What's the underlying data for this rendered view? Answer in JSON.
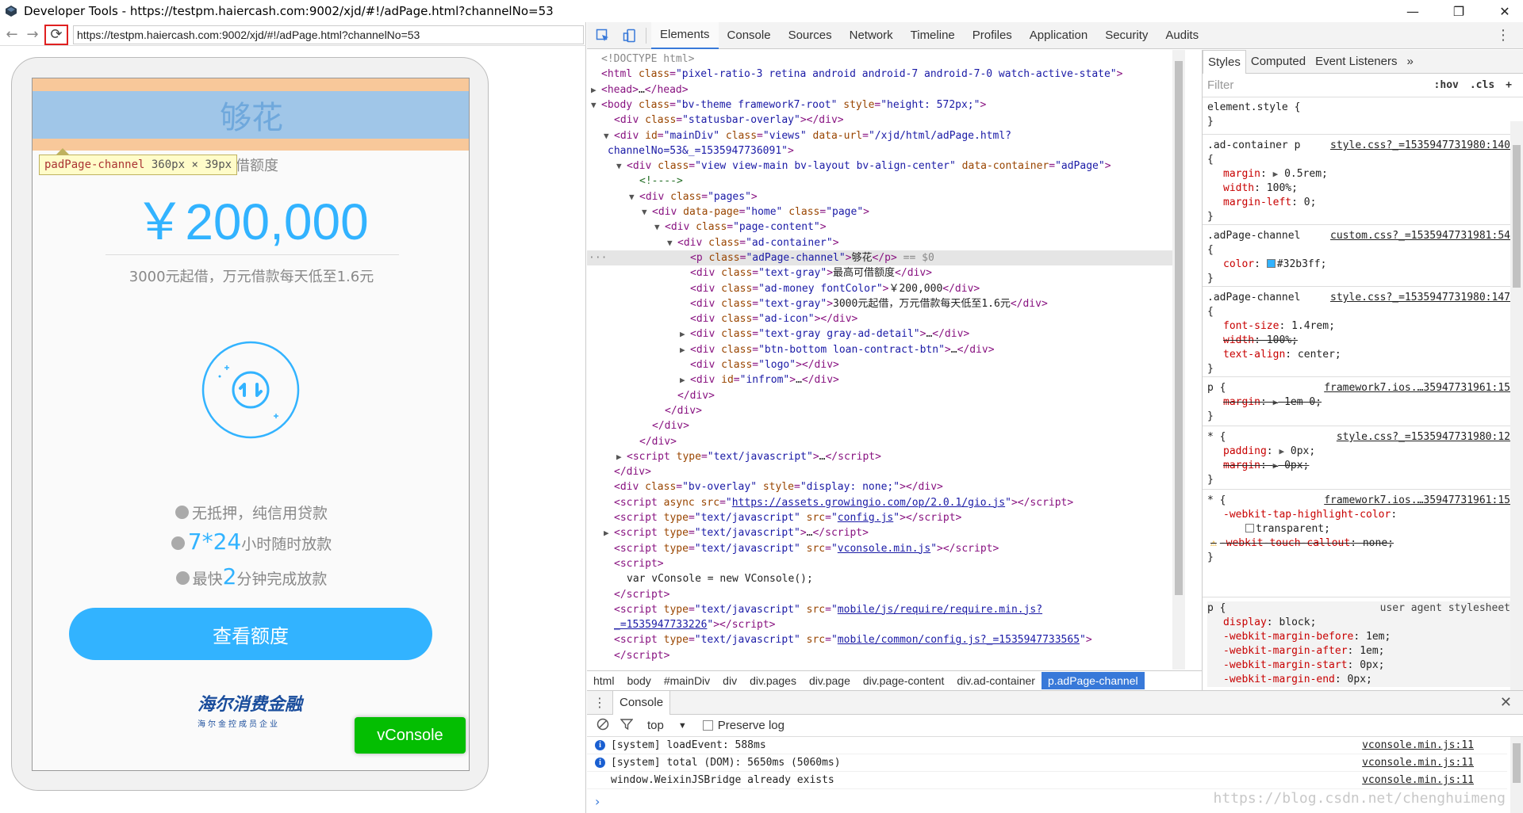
{
  "window": {
    "title": "Developer Tools - https://testpm.haiercash.com:9002/xjd/#!/adPage.html?channelNo=53",
    "minimize": "—",
    "restore": "❐",
    "close": "✕"
  },
  "device": {
    "url": "https://testpm.haiercash.com:9002/xjd/#!/adPage.html?channelNo=53",
    "channel_title": "够花",
    "tooltip": {
      "name": "padPage-channel",
      "width": "360",
      "x": "×",
      "height": "39",
      "unit": "px"
    },
    "max_label": "高可借额度",
    "money": "￥200,000",
    "sub_text": "3000元起借，万元借款每天低至1.6元",
    "feature1": "无抵押，纯信用贷款",
    "feature2_hl": "7*24",
    "feature2": "小时随时放款",
    "feature3_pre": "最快",
    "feature3_hl": "2",
    "feature3_post": "分钟完成放款",
    "cta": "查看额度",
    "logo_main": "海尔消费金融",
    "logo_sub": "海尔金控成员企业",
    "vconsole": "vConsole",
    "accent": "#32b3ff"
  },
  "devtools": {
    "tabs": [
      "Elements",
      "Console",
      "Sources",
      "Network",
      "Timeline",
      "Profiles",
      "Application",
      "Security",
      "Audits"
    ],
    "active_tab": "Elements",
    "breadcrumbs": [
      "html",
      "body",
      "#mainDiv",
      "div",
      "div.pages",
      "div.page",
      "div.page-content",
      "div.ad-container",
      "p.adPage-channel"
    ],
    "styles_tabs": [
      "Styles",
      "Computed",
      "Event Listeners",
      "»"
    ],
    "filter_placeholder": "Filter",
    "hov": ":hov",
    "cls": ".cls",
    "add": "+"
  },
  "tree": [
    {
      "i": 0,
      "html": "<span class='gr'>&lt;!DOCTYPE html&gt;</span>"
    },
    {
      "i": 0,
      "html": "<span class='tg'>&lt;html</span> <span class='an'>class</span>=<span class='av'>\"pixel-ratio-3 retina android android-7 android-7-0 watch-active-state\"</span><span class='tg'>&gt;</span>"
    },
    {
      "i": 0,
      "tri": "▶",
      "html": "<span class='tg'>&lt;head&gt;</span><span class='tx'>…</span><span class='tg'>&lt;/head&gt;</span>"
    },
    {
      "i": 0,
      "tri": "▼",
      "html": "<span class='tg'>&lt;body</span> <span class='an'>class</span>=<span class='av'>\"bv-theme framework7-root\"</span> <span class='an'>style</span>=<span class='av'>\"height: 572px;\"</span><span class='tg'>&gt;</span>"
    },
    {
      "i": 1,
      "html": "<span class='tg'>&lt;div</span> <span class='an'>class</span>=<span class='av'>\"statusbar-overlay\"</span><span class='tg'>&gt;&lt;/div&gt;</span>"
    },
    {
      "i": 1,
      "tri": "▼",
      "html": "<span class='tg'>&lt;div</span> <span class='an'>id</span>=<span class='av'>\"mainDiv\"</span> <span class='an'>class</span>=<span class='av'>\"views\"</span> <span class='an'>data-url</span>=<span class='av'>\"/xjd/html/adPage.html?</span>"
    },
    {
      "i": 0.5,
      "html": "<span class='av'>channelNo=53&amp;_=1535947736091\"</span><span class='tg'>&gt;</span>"
    },
    {
      "i": 2,
      "tri": "▼",
      "html": "<span class='tg'>&lt;div</span> <span class='an'>class</span>=<span class='av'>\"view view-main bv-layout bv-align-center\"</span> <span class='an'>data-container</span>=<span class='av'>\"adPage\"</span><span class='tg'>&gt;</span>"
    },
    {
      "i": 3,
      "html": "<span class='cm'>&lt;!----&gt;</span>"
    },
    {
      "i": 3,
      "tri": "▼",
      "html": "<span class='tg'>&lt;div</span> <span class='an'>class</span>=<span class='av'>\"pages\"</span><span class='tg'>&gt;</span>"
    },
    {
      "i": 4,
      "tri": "▼",
      "html": "<span class='tg'>&lt;div</span> <span class='an'>data-page</span>=<span class='av'>\"home\"</span> <span class='an'>class</span>=<span class='av'>\"page\"</span><span class='tg'>&gt;</span>"
    },
    {
      "i": 5,
      "tri": "▼",
      "html": "<span class='tg'>&lt;div</span> <span class='an'>class</span>=<span class='av'>\"page-content\"</span><span class='tg'>&gt;</span>"
    },
    {
      "i": 6,
      "tri": "▼",
      "html": "<span class='tg'>&lt;div</span> <span class='an'>class</span>=<span class='av'>\"ad-container\"</span><span class='tg'>&gt;</span>"
    },
    {
      "i": 7,
      "sel": true,
      "html": "<span class='tg'>&lt;p</span> <span class='an'>class</span>=<span class='av'>\"adPage-channel\"</span><span class='tg'>&gt;</span><span class='tx'>够花</span><span class='tg'>&lt;/p&gt;</span> <span class='gr'>== $0</span>"
    },
    {
      "i": 7,
      "html": "<span class='tg'>&lt;div</span> <span class='an'>class</span>=<span class='av'>\"text-gray\"</span><span class='tg'>&gt;</span><span class='tx'>最高可借额度</span><span class='tg'>&lt;/div&gt;</span>"
    },
    {
      "i": 7,
      "html": "<span class='tg'>&lt;div</span> <span class='an'>class</span>=<span class='av'>\"ad-money fontColor\"</span><span class='tg'>&gt;</span><span class='tx'>￥200,000</span><span class='tg'>&lt;/div&gt;</span>"
    },
    {
      "i": 7,
      "html": "<span class='tg'>&lt;div</span> <span class='an'>class</span>=<span class='av'>\"text-gray\"</span><span class='tg'>&gt;</span><span class='tx'>3000元起借，万元借款每天低至1.6元</span><span class='tg'>&lt;/div&gt;</span>"
    },
    {
      "i": 7,
      "html": "<span class='tg'>&lt;div</span> <span class='an'>class</span>=<span class='av'>\"ad-icon\"</span><span class='tg'>&gt;&lt;/div&gt;</span>"
    },
    {
      "i": 7,
      "tri": "▶",
      "html": "<span class='tg'>&lt;div</span> <span class='an'>class</span>=<span class='av'>\"text-gray gray-ad-detail\"</span><span class='tg'>&gt;</span><span class='tx'>…</span><span class='tg'>&lt;/div&gt;</span>"
    },
    {
      "i": 7,
      "tri": "▶",
      "html": "<span class='tg'>&lt;div</span> <span class='an'>class</span>=<span class='av'>\"btn-bottom loan-contract-btn\"</span><span class='tg'>&gt;</span><span class='tx'>…</span><span class='tg'>&lt;/div&gt;</span>"
    },
    {
      "i": 7,
      "html": "<span class='tg'>&lt;div</span> <span class='an'>class</span>=<span class='av'>\"logo\"</span><span class='tg'>&gt;&lt;/div&gt;</span>"
    },
    {
      "i": 7,
      "tri": "▶",
      "html": "<span class='tg'>&lt;div</span> <span class='an'>id</span>=<span class='av'>\"infrom\"</span><span class='tg'>&gt;</span><span class='tx'>…</span><span class='tg'>&lt;/div&gt;</span>"
    },
    {
      "i": 6,
      "html": "<span class='tg'>&lt;/div&gt;</span>"
    },
    {
      "i": 5,
      "html": "<span class='tg'>&lt;/div&gt;</span>"
    },
    {
      "i": 4,
      "html": "<span class='tg'>&lt;/div&gt;</span>"
    },
    {
      "i": 3,
      "html": "<span class='tg'>&lt;/div&gt;</span>"
    },
    {
      "i": 2,
      "tri": "▶",
      "html": "<span class='tg'>&lt;script</span> <span class='an'>type</span>=<span class='av'>\"text/javascript\"</span><span class='tg'>&gt;</span><span class='tx'>…</span><span class='tg'>&lt;/script&gt;</span>"
    },
    {
      "i": 1,
      "html": "<span class='tg'>&lt;/div&gt;</span>"
    },
    {
      "i": 1,
      "html": "<span class='tg'>&lt;div</span> <span class='an'>class</span>=<span class='av'>\"bv-overlay\"</span> <span class='an'>style</span>=<span class='av'>\"display: none;\"</span><span class='tg'>&gt;&lt;/div&gt;</span>"
    },
    {
      "i": 1,
      "html": "<span class='tg'>&lt;script</span> <span class='an'>async src</span>=<span class='av'>\"</span><span class='lk'>https://assets.growingio.com/op/2.0.1/gio.js</span><span class='av'>\"</span><span class='tg'>&gt;&lt;/script&gt;</span>"
    },
    {
      "i": 1,
      "html": "<span class='tg'>&lt;script</span> <span class='an'>type</span>=<span class='av'>\"text/javascript\"</span> <span class='an'>src</span>=<span class='av'>\"</span><span class='lk'>config.js</span><span class='av'>\"</span><span class='tg'>&gt;&lt;/script&gt;</span>"
    },
    {
      "i": 1,
      "tri": "▶",
      "html": "<span class='tg'>&lt;script</span> <span class='an'>type</span>=<span class='av'>\"text/javascript\"</span><span class='tg'>&gt;</span><span class='tx'>…</span><span class='tg'>&lt;/script&gt;</span>"
    },
    {
      "i": 1,
      "html": "<span class='tg'>&lt;script</span> <span class='an'>type</span>=<span class='av'>\"text/javascript\"</span> <span class='an'>src</span>=<span class='av'>\"</span><span class='lk'>vconsole.min.js</span><span class='av'>\"</span><span class='tg'>&gt;&lt;/script&gt;</span>"
    },
    {
      "i": 1,
      "html": "<span class='tg'>&lt;script&gt;</span>"
    },
    {
      "i": 2,
      "html": "<span class='tx'>var vConsole = new VConsole();</span>"
    },
    {
      "i": 1,
      "html": "<span class='tg'>&lt;/script&gt;</span>"
    },
    {
      "i": 1,
      "html": "<span class='tg'>&lt;script</span> <span class='an'>type</span>=<span class='av'>\"text/javascript\"</span> <span class='an'>src</span>=<span class='av'>\"</span><span class='lk'>mobile/js/require/require.min.js?</span>"
    },
    {
      "i": 1,
      "html": "<span class='lk'>_=1535947733226</span><span class='av'>\"</span><span class='tg'>&gt;&lt;/script&gt;</span>"
    },
    {
      "i": 1,
      "html": "<span class='tg'>&lt;script</span> <span class='an'>type</span>=<span class='av'>\"text/javascript\"</span> <span class='an'>src</span>=<span class='av'>\"</span><span class='lk'>mobile/common/config.js?_=1535947733565</span><span class='av'>\"</span><span class='tg'>&gt;</span>"
    },
    {
      "i": 1,
      "html": "<span class='tg'>&lt;/script&gt;</span>"
    }
  ],
  "styles": {
    "element_style": "element.style {",
    "r1_sel": ".ad-container p",
    "r1_src": "style.css?_=1535947731980:140",
    "r2_sel": ".adPage-channel",
    "r2_src": "custom.css?_=1535947731981:54",
    "r3_sel": ".adPage-channel",
    "r3_src": "style.css?_=1535947731980:147",
    "r4_sel": "p {",
    "r4_src": "framework7.ios.…35947731961:15",
    "r5_sel": "* {",
    "r5_src": "style.css?_=1535947731980:12",
    "r6_sel": "* {",
    "r6_src": "framework7.ios.…35947731961:15",
    "r7_sel": "p {",
    "r7_src": "user agent stylesheet"
  },
  "console": {
    "tab": "Console",
    "context": "top",
    "preserve_log": "Preserve log",
    "messages": [
      {
        "text": "[system] loadEvent: 588ms",
        "src": "vconsole.min.js:11"
      },
      {
        "text": "[system] total (DOM): 5650ms (5060ms)",
        "src": "vconsole.min.js:11"
      },
      {
        "text": "window.WeixinJSBridge already exists",
        "src": "vconsole.min.js:11"
      }
    ]
  },
  "watermark": "https://blog.csdn.net/chenghuimeng"
}
